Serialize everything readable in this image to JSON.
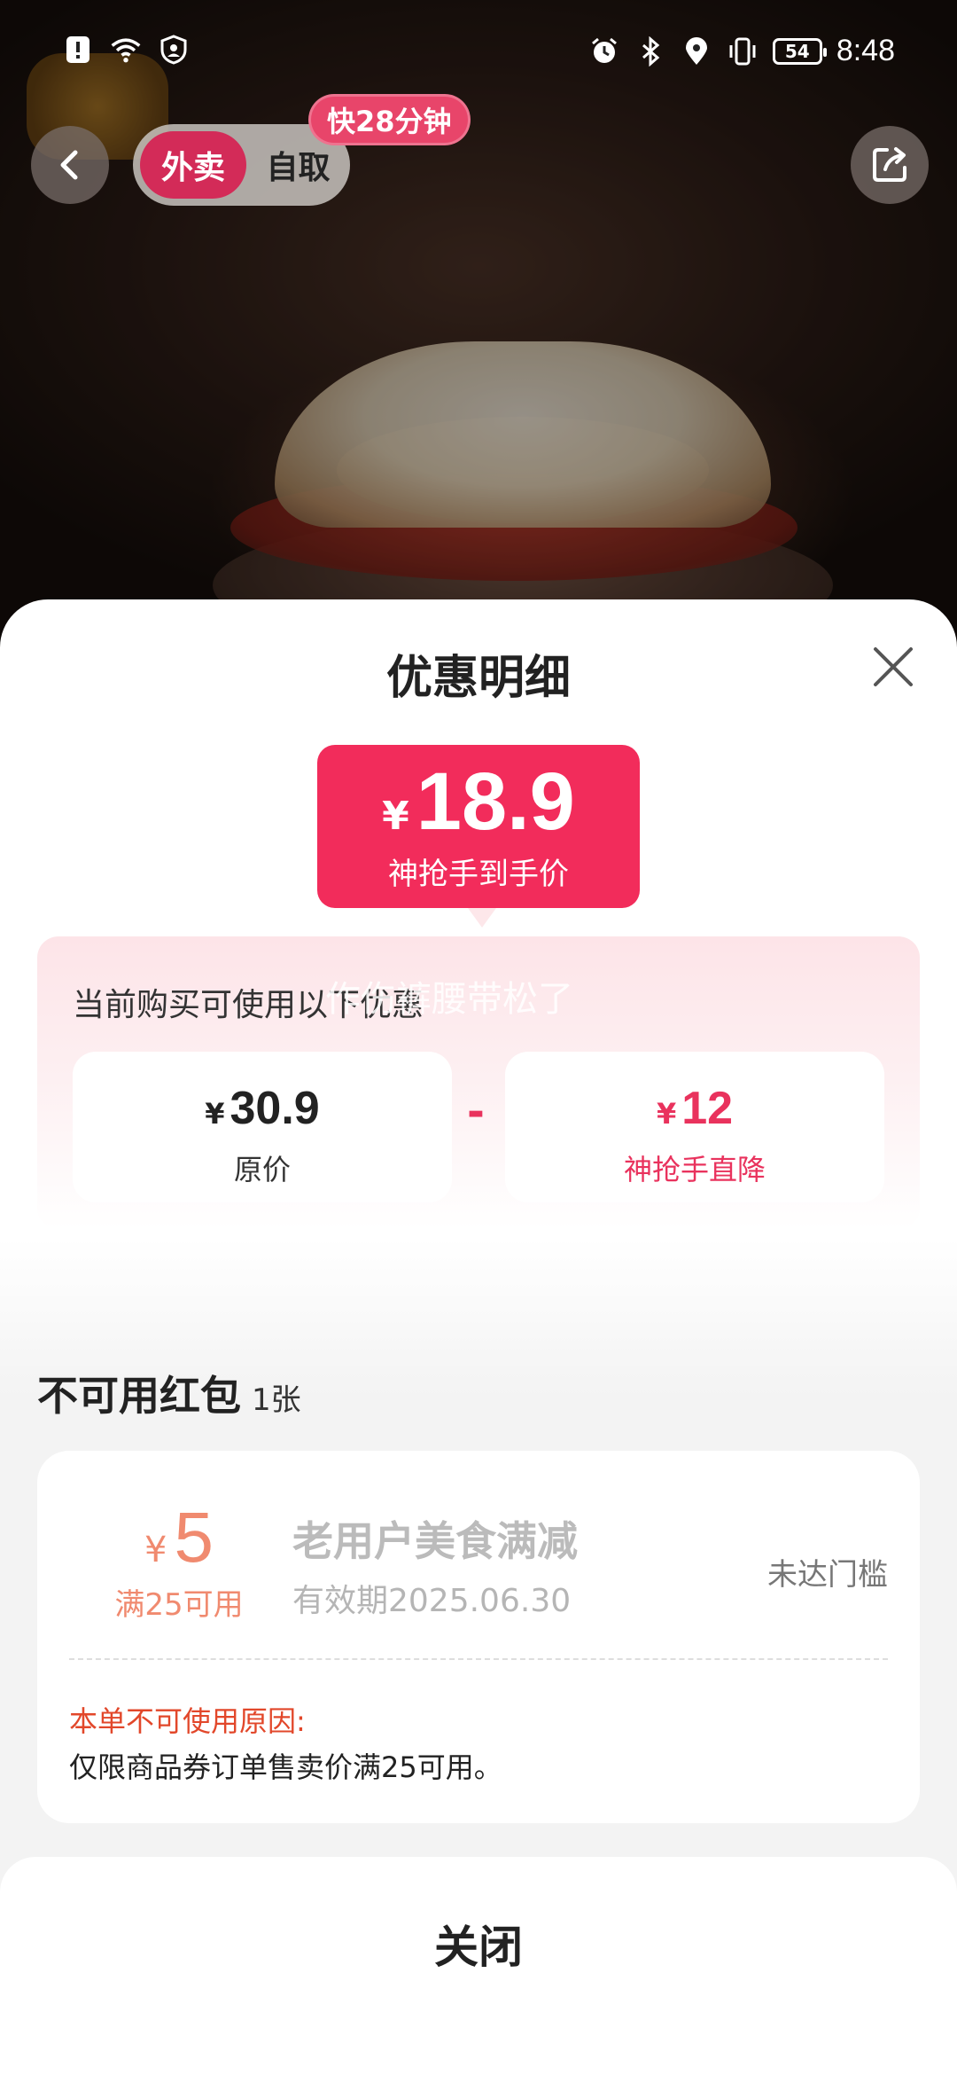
{
  "status_bar": {
    "time": "8:48",
    "battery": "54",
    "icons_left": [
      "alert-icon",
      "wifi-icon",
      "shield-icon"
    ],
    "icons_right": [
      "alarm-icon",
      "bluetooth-icon",
      "location-icon",
      "vibrate-icon",
      "battery-icon"
    ]
  },
  "header": {
    "mode_active": "外卖",
    "mode_inactive": "自取",
    "eta_badge": "快28分钟"
  },
  "sheet": {
    "title": "优惠明细",
    "final_price": {
      "currency": "¥",
      "value": "18.9",
      "label": "神抢手到手价"
    },
    "promo": {
      "caption": "当前购买可使用以下优惠",
      "watermark": "作伤裤腰带松了",
      "original": {
        "currency": "¥",
        "value": "30.9",
        "label": "原价"
      },
      "operator": "-",
      "discount": {
        "currency": "¥",
        "value": "12",
        "label": "神抢手直降"
      }
    },
    "unavailable": {
      "title": "不可用红包",
      "count": "1张",
      "coupon": {
        "currency": "¥",
        "value": "5",
        "condition": "满25可用",
        "name": "老用户美食满减",
        "validity": "有效期2025.06.30",
        "status": "未达门槛",
        "reason_title": "本单不可使用原因:",
        "reason": "仅限商品券订单售卖价满25可用。"
      }
    },
    "close_label": "关闭"
  },
  "colors": {
    "accent": "#f22c5b",
    "mode_active": "#d32b58",
    "coupon_orange": "#f08a6f",
    "reason_red": "#e2472a"
  }
}
